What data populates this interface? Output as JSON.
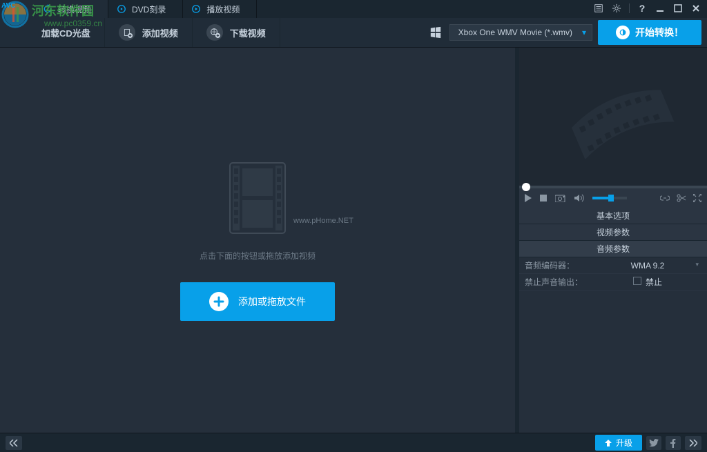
{
  "watermark": {
    "logo_text": "河东软件园",
    "url": "www.pc0359.cn",
    "center": "www.pHome.NET"
  },
  "tabs": {
    "items": [
      {
        "label": "转换视频"
      },
      {
        "label": "DVD刻录"
      },
      {
        "label": "播放视频"
      }
    ]
  },
  "toolbar": {
    "load_cd": "加载CD光盘",
    "add_video": "添加视频",
    "download_video": "下载视频",
    "format": "Xbox One WMV Movie (*.wmv)",
    "convert": "开始转换！"
  },
  "main": {
    "hint": "点击下面的按钮或拖放添加视频",
    "add_file": "添加或拖放文件"
  },
  "sidebar": {
    "tabs": {
      "basic": "基本选项",
      "video": "视频参数",
      "audio": "音频参数"
    },
    "params": {
      "codec_label": "音频编码器：",
      "codec_value": "WMA 9.2",
      "mute_label": "禁止声音输出：",
      "mute_value": "禁止"
    }
  },
  "bottom": {
    "upgrade": "升级"
  },
  "colors": {
    "accent": "#08a0e9",
    "bg": "#1a2630",
    "panel": "#252f3b"
  }
}
